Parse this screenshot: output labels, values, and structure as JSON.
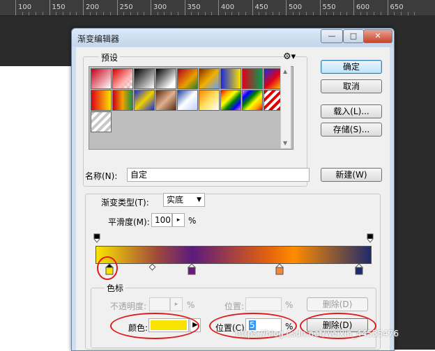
{
  "ruler": {
    "ticks": [
      "100",
      "150",
      "200",
      "250",
      "300",
      "350",
      "400",
      "450",
      "500",
      "550",
      "600",
      "650"
    ]
  },
  "window": {
    "title": "渐变编辑器",
    "controls": {
      "minimize": "—",
      "maximize": "□",
      "close": "✕"
    }
  },
  "presets": {
    "label": "预设",
    "menu_icon": "gear-icon",
    "swatches": [
      "linear-gradient(135deg,#c8001a,#ffffff)",
      "linear-gradient(135deg,#d40000,#ffb0b0 60%,transparent)",
      "linear-gradient(135deg,#000,#fff)",
      "linear-gradient(135deg,#000,#fff 80%)",
      "linear-gradient(135deg,#b3001a,#e8a000 60%,#2a7d2a)",
      "linear-gradient(135deg,#8a2b00,#f0b000,#6aa0ff)",
      "linear-gradient(90deg,#1a2ae0,#fbe400)",
      "linear-gradient(90deg,#e0001a,#00a050)",
      "linear-gradient(135deg,#1a2ae0,#e0001a,#fbe400)",
      "linear-gradient(90deg,#e0001a,#fbe400)",
      "linear-gradient(90deg,#c8001a,#f0a000,#1a9040)",
      "linear-gradient(135deg,#1a2ae0,#f0d000,#1a2ae0)",
      "linear-gradient(135deg,#5a2a10,#e0b090,#5a2a10)",
      "linear-gradient(135deg,#1a40a0,#ffffff,#c0d0ff)",
      "linear-gradient(135deg,#ff8a00,#ffe060,#fff)",
      "linear-gradient(135deg,red,orange,yellow,green,blue,violet)",
      "linear-gradient(135deg,violet,blue,green,yellow,orange,red)",
      "repeating-linear-gradient(135deg,#e00000 0 4px,#ffffff 4px 8px)",
      "repeating-linear-gradient(135deg,#c8c8c8 0 4px,#ffffff 4px 8px)"
    ]
  },
  "buttons": {
    "ok": "确定",
    "cancel": "取消",
    "load": "载入(L)...",
    "save": "存储(S)...",
    "new": "新建(W)"
  },
  "name": {
    "label": "名称(N):",
    "value": "自定"
  },
  "gradient_type": {
    "label": "渐变类型(T):",
    "value": "实底"
  },
  "smoothness": {
    "label": "平滑度(M):",
    "value": "100",
    "unit": "%"
  },
  "stops_group": {
    "label": "色标",
    "opacity_label": "不透明度:",
    "opacity_unit": "%",
    "opacity_location_label": "位置:",
    "opacity_location_unit": "%",
    "delete_top": "删除(D)",
    "color_label": "颜色:",
    "color_value": "#f8e400",
    "color_location_label": "位置(C):",
    "color_location_value": "5",
    "color_location_unit": "%",
    "delete_bottom": "删除(D)"
  },
  "color_stops": [
    {
      "position": 5,
      "color": "#f8e400",
      "selected": true
    },
    {
      "position": 35,
      "color": "#6a1a7e"
    },
    {
      "position": 67,
      "color": "#f08a3a"
    },
    {
      "position": 96,
      "color": "#1e2a6a"
    }
  ],
  "opacity_stops": [
    {
      "position": 0
    },
    {
      "position": 100
    }
  ],
  "watermark": "https://blog.csdn.net/weixin_44535476"
}
